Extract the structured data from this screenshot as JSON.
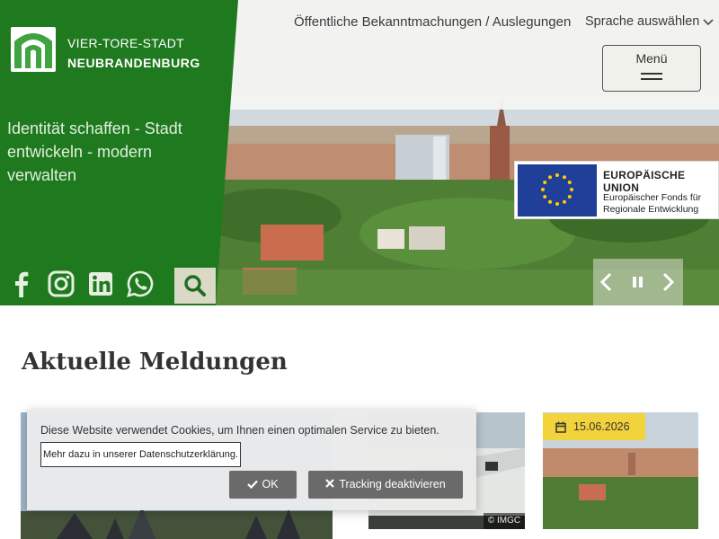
{
  "header": {
    "logo_line1": "VIER-TORE-STADT",
    "logo_line2": "NEUBRANDENBURG",
    "slogan": "Identität schaffen - Stadt entwickeln - modern verwalten",
    "top_link_announcements": "Öffentliche Bekanntmachungen / Auslegungen",
    "top_link_language": "Sprache auswählen",
    "menu_label": "Menü"
  },
  "social_icons": [
    "facebook-icon",
    "instagram-icon",
    "linkedin-icon",
    "whatsapp-icon"
  ],
  "eu_badge": {
    "title": "EUROPÄISCHE UNION",
    "line1": "Europäischer Fonds für",
    "line2": "Regionale Entwicklung"
  },
  "news": {
    "title": "Aktuelle Meldungen",
    "card2_copyright": "© IMGC",
    "card3_date": "15.06.2026"
  },
  "cookie": {
    "text": "Diese Website verwendet Cookies, um Ihnen einen optimalen Service zu bieten.",
    "privacy_link": "Mehr dazu in unserer Datenschutzerklärung.",
    "ok_label": "OK",
    "deactivate_label": "Tracking deaktivieren"
  },
  "colors": {
    "brand_green": "#1f7a1f",
    "search_bg": "#d9d9c6",
    "date_badge": "#f3d33b",
    "eu_blue": "#1f3f99"
  }
}
